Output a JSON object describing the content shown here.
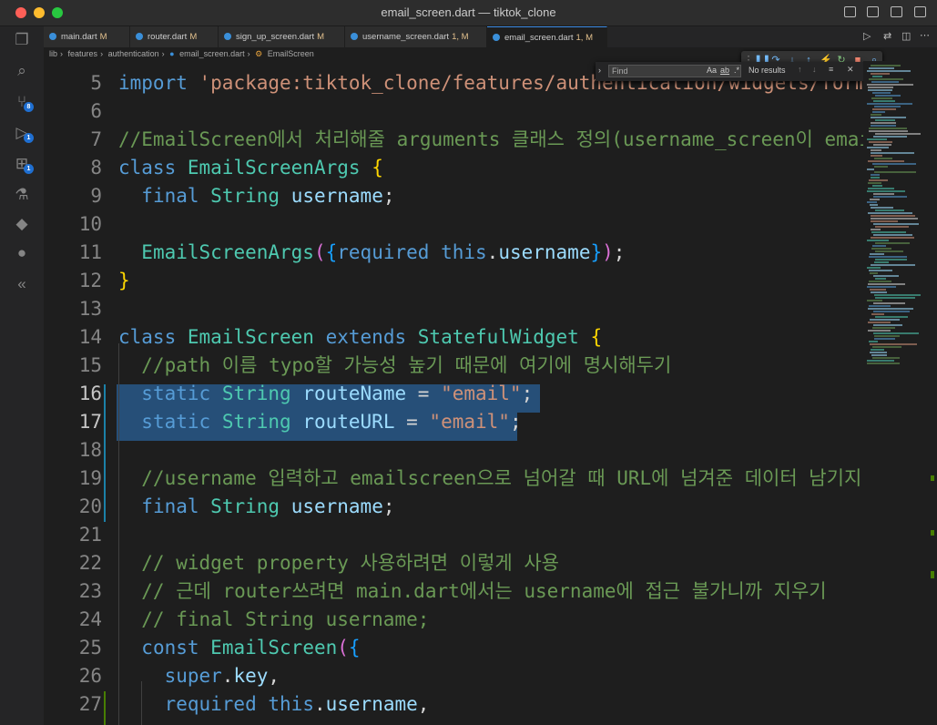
{
  "window": {
    "title": "email_screen.dart — tiktok_clone"
  },
  "tabs": [
    {
      "name": "main.dart",
      "status": "M"
    },
    {
      "name": "router.dart",
      "status": "M"
    },
    {
      "name": "sign_up_screen.dart",
      "status": "M"
    },
    {
      "name": "username_screen.dart",
      "status": "1, M"
    },
    {
      "name": "email_screen.dart",
      "status": "1, M"
    }
  ],
  "breadcrumb": [
    "lib",
    "features",
    "authentication",
    "email_screen.dart",
    "EmailScreen"
  ],
  "find": {
    "placeholder": "Find",
    "opt_case": "Aa",
    "opt_word": "ab",
    "opt_regex": ".*",
    "result": "No results"
  },
  "activity_badges": {
    "source_control": "8",
    "run_debug": "1",
    "extensions": "1"
  },
  "line_numbers": [
    "5",
    "6",
    "7",
    "8",
    "9",
    "10",
    "11",
    "12",
    "13",
    "14",
    "15",
    "16",
    "17",
    "18",
    "19",
    "20",
    "21",
    "22",
    "23",
    "24",
    "25",
    "26",
    "27"
  ],
  "code_lines": [
    "import 'package:tiktok_clone/features/authentication/widgets/form_",
    "",
    "//EmailScreen에서 처리해줄 arguments 클래스 정의(username_screen이 email_",
    "class EmailScreenArgs {",
    "  final String username;",
    "",
    "  EmailScreenArgs({required this.username});",
    "}",
    "",
    "class EmailScreen extends StatefulWidget {",
    "  //path 이름 typo할 가능성 높기 때문에 여기에 명시해두기",
    "  static String routeName = \"email\";",
    "  static String routeURL = \"email\";",
    "",
    "  //username 입력하고 emailscreen으로 넘어갈 때 URL에 넘겨준 데이터 남기지 않기",
    "  final String username;",
    "",
    "  // widget property 사용하려면 이렇게 사용",
    "  // 근데 router쓰려면 main.dart에서는 username에 접근 불가니까 지우기",
    "  // final String username;",
    "  const EmailScreen({",
    "    super.key,",
    "    required this.username,"
  ],
  "colors": {
    "keyword": "#569cd6",
    "type": "#4ec9b0",
    "string": "#ce9178",
    "comment": "#6a9955",
    "variable": "#9cdcfe",
    "selection": "#264f78"
  }
}
